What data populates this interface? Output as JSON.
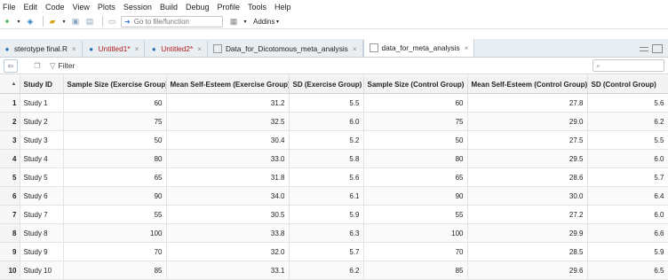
{
  "menu": [
    "File",
    "Edit",
    "Code",
    "View",
    "Plots",
    "Session",
    "Build",
    "Debug",
    "Profile",
    "Tools",
    "Help"
  ],
  "toolbar": {
    "goto_placeholder": "Go to file/function",
    "addins_label": "Addins"
  },
  "tabs": [
    {
      "label": "sterotype final.R",
      "modified": false
    },
    {
      "label": "Untitled1*",
      "modified": true
    },
    {
      "label": "Untitled2*",
      "modified": true
    },
    {
      "label": "Data_for_Dicotomous_meta_analysis",
      "modified": false
    },
    {
      "label": "data_for_meta_analysis",
      "modified": false
    }
  ],
  "filter": {
    "label": "Filter"
  },
  "table": {
    "headers": [
      "Study ID",
      "Sample Size (Exercise Group)",
      "Mean Self-Esteem (Exercise Group)",
      "SD (Exercise Group)",
      "Sample Size (Control Group)",
      "Mean Self-Esteem (Control Group)",
      "SD (Control Group)"
    ],
    "rows": [
      [
        "1",
        "Study 1",
        "60",
        "31.2",
        "5.5",
        "60",
        "27.8",
        "5.6"
      ],
      [
        "2",
        "Study 2",
        "75",
        "32.5",
        "6.0",
        "75",
        "29.0",
        "6.2"
      ],
      [
        "3",
        "Study 3",
        "50",
        "30.4",
        "5.2",
        "50",
        "27.5",
        "5.5"
      ],
      [
        "4",
        "Study 4",
        "80",
        "33.0",
        "5.8",
        "80",
        "29.5",
        "6.0"
      ],
      [
        "5",
        "Study 5",
        "65",
        "31.8",
        "5.6",
        "65",
        "28.6",
        "5.7"
      ],
      [
        "6",
        "Study 6",
        "90",
        "34.0",
        "6.1",
        "90",
        "30.0",
        "6.4"
      ],
      [
        "7",
        "Study 7",
        "55",
        "30.5",
        "5.9",
        "55",
        "27.2",
        "6.0"
      ],
      [
        "8",
        "Study 8",
        "100",
        "33.8",
        "6.3",
        "100",
        "29.9",
        "6.6"
      ],
      [
        "9",
        "Study 9",
        "70",
        "32.0",
        "5.7",
        "70",
        "28.5",
        "5.9"
      ],
      [
        "10",
        "Study 10",
        "85",
        "33.1",
        "6.2",
        "85",
        "29.6",
        "6.5"
      ]
    ]
  }
}
